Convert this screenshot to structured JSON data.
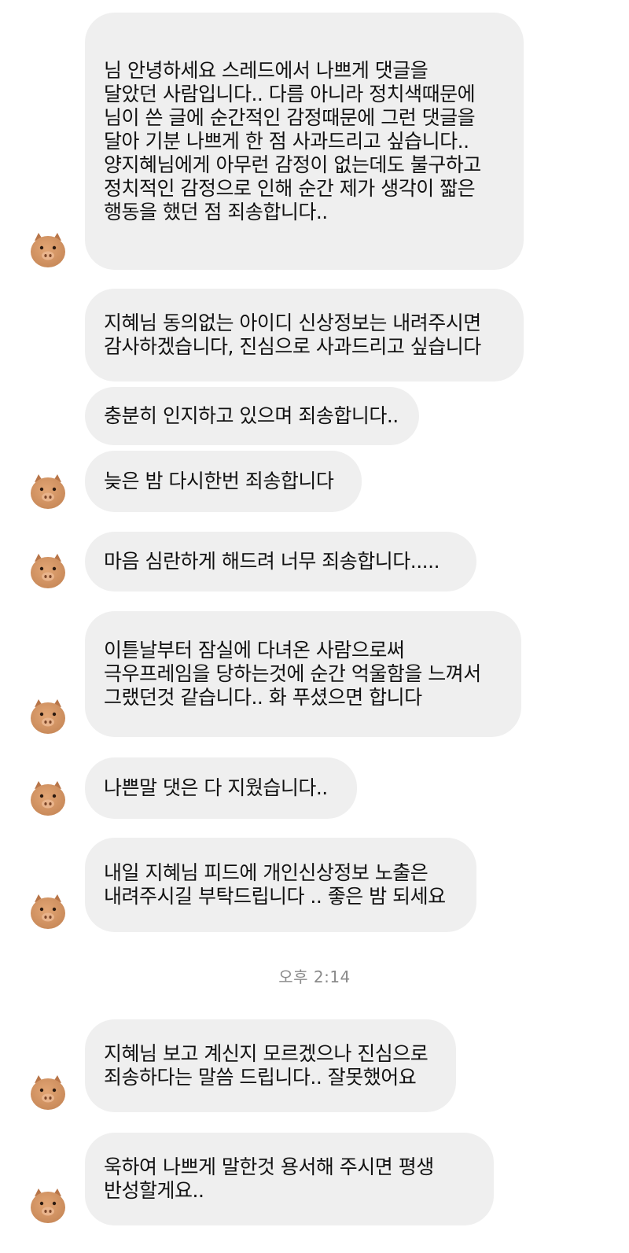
{
  "conversation": {
    "timestamp": "오후 2:14",
    "messages": [
      {
        "text": "님 안녕하세요 스레드에서 나쁘게 댓글을\n달았던 사람입니다.. 다름 아니라 정치색때문에\n님이 쓴 글에 순간적인 감정때문에 그런 댓글을\n달아 기분 나쁘게 한 점 사과드리고 싶습니다..\n양지혜님에게 아무런 감정이 없는데도 불구하고\n정치적인 감정으로 인해 순간 제가 생각이 짧은\n행동을 했던 점 죄송합니다.."
      },
      {
        "text": "지혜님 동의없는 아이디 신상정보는 내려주시면\n감사하겠습니다, 진심으로 사과드리고 싶습니다"
      },
      {
        "text": "충분히 인지하고 있으며 죄송합니다.."
      },
      {
        "text": "늦은 밤 다시한번 죄송합니다"
      },
      {
        "text": "마음 심란하게 해드려 너무 죄송합니다....."
      },
      {
        "text": "이튿날부터 잠실에 다녀온 사람으로써\n극우프레임을 당하는것에 순간 억울함을 느껴서\n그랬던것 같습니다.. 화 푸셨으면 합니다"
      },
      {
        "text": "나쁜말 댓은 다 지웠습니다.."
      },
      {
        "text": "내일  지혜님 피드에 개인신상정보 노출은\n내려주시길 부탁드립니다 .. 좋은 밤 되세요"
      },
      {
        "text": "지혜님 보고 계신지 모르겠으나 진심으로\n죄송하다는 말씀 드립니다.. 잘못했어요"
      },
      {
        "text": "욱하여 나쁘게 말한것 용서해 주시면 평생\n반성할게요.."
      }
    ]
  },
  "colors": {
    "bubble_background": "#efefef",
    "text": "#111111",
    "timestamp": "#8a8a8a",
    "avatar_skin": "#c98a5a"
  },
  "icons": {
    "avatar": "pig-avatar-icon"
  }
}
